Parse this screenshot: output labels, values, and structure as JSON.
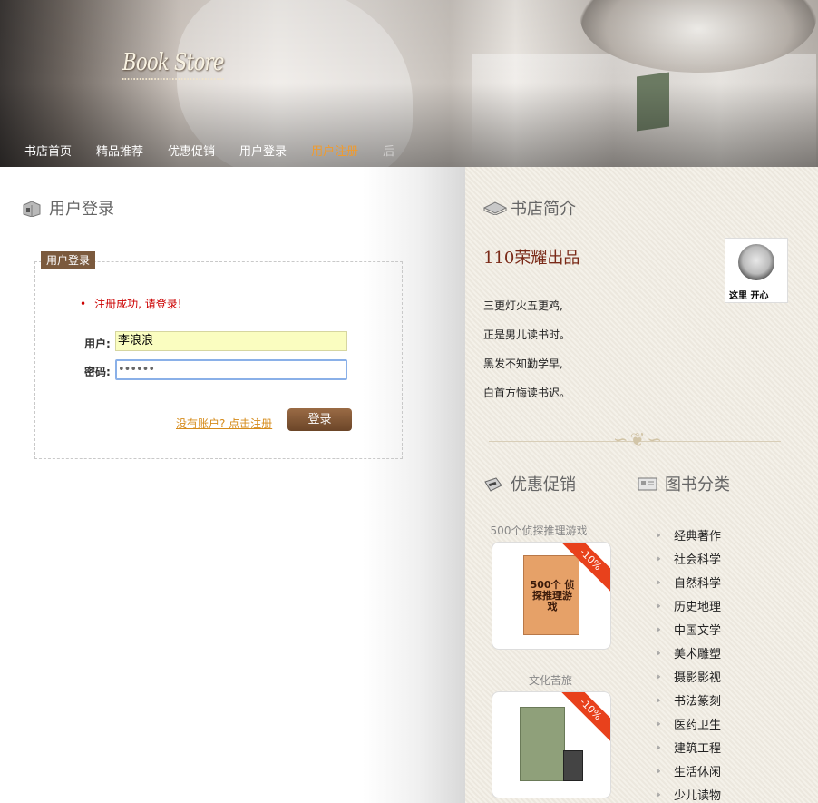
{
  "header": {
    "logo": "Book Store",
    "nav": [
      "书店首页",
      "精品推荐",
      "优惠促销",
      "用户登录",
      "用户注册",
      "后"
    ],
    "active_nav": "用户注册",
    "colors": {
      "nav_text": "#ffffff",
      "nav_active": "#f19b2c"
    }
  },
  "login": {
    "section_title": "用户登录",
    "legend": "用户登录",
    "message": "注册成功, 请登录!",
    "username_label": "用户:",
    "username_value": "李浪浪",
    "password_label": "密码:",
    "password_value": "••••••",
    "register_link": "没有账户? 点击注册",
    "submit_label": "登录"
  },
  "intro": {
    "section_title": "书店简介",
    "headline_num": "110",
    "headline_text": "荣耀出品",
    "meme_caption": "这里 开心",
    "poem": [
      "三更灯火五更鸡,",
      "正是男儿读书时。",
      "黑发不知勤学早,",
      "白首方悔读书迟。"
    ]
  },
  "promo": {
    "section_title": "优惠促销",
    "books": [
      {
        "name": "500个侦探推理游戏",
        "badge": "-10%",
        "cover_text": "500个 侦探推理游戏"
      },
      {
        "name": "文化苦旅",
        "badge": "-10%"
      }
    ]
  },
  "categories": {
    "section_title": "图书分类",
    "items": [
      "经典著作",
      "社会科学",
      "自然科学",
      "历史地理",
      "中国文学",
      "美术雕塑",
      "摄影影视",
      "书法篆刻",
      "医药卫生",
      "建筑工程",
      "生活休闲",
      "少儿读物"
    ]
  }
}
